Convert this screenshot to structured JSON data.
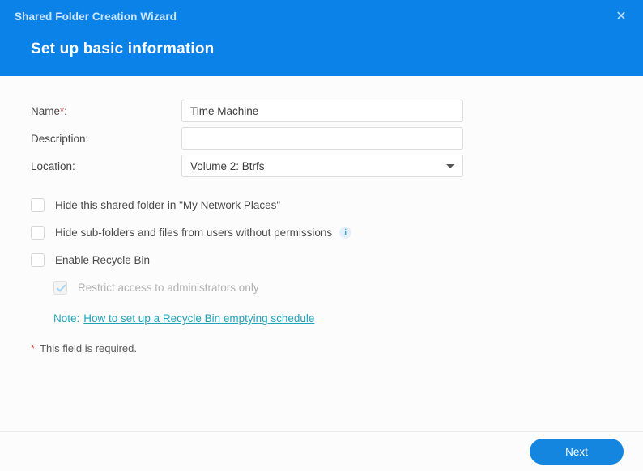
{
  "window": {
    "title": "Shared Folder Creation Wizard",
    "close_icon": "close-icon",
    "heading": "Set up basic information",
    "header_color": "#0b82e8"
  },
  "form": {
    "name": {
      "label": "Name",
      "required_marker": "*",
      "colon": ":",
      "value": "Time Machine",
      "placeholder": ""
    },
    "description": {
      "label": "Description:",
      "value": "",
      "placeholder": ""
    },
    "location": {
      "label": "Location:",
      "value": "Volume 2:  Btrfs",
      "caret_icon": "chevron-down-icon"
    }
  },
  "options": [
    {
      "label": "Hide this shared folder in \"My Network Places\"",
      "checked": false,
      "disabled": false,
      "info": false
    },
    {
      "label": "Hide sub-folders and files from users without permissions",
      "checked": false,
      "disabled": false,
      "info": true,
      "info_icon": "info-icon",
      "info_glyph": "i"
    },
    {
      "label": "Enable Recycle Bin",
      "checked": false,
      "disabled": false,
      "info": false
    },
    {
      "label": "Restrict access to administrators only",
      "checked": true,
      "disabled": true,
      "info": false
    }
  ],
  "note": {
    "prefix": "Note:",
    "link_text": "How to set up a Recycle Bin emptying schedule",
    "color": "#1fa3b8"
  },
  "required_note": {
    "star": "*",
    "text": "This field is required."
  },
  "footer": {
    "next_label": "Next",
    "accent_color": "#1586e0"
  }
}
